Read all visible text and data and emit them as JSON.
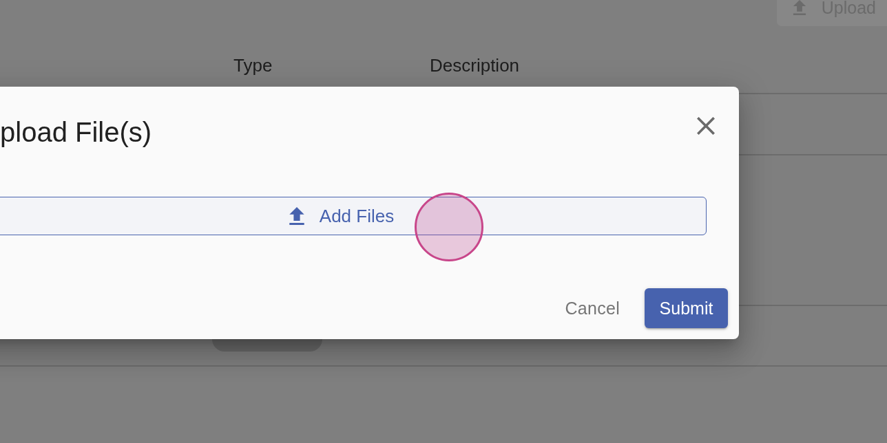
{
  "toolbar": {
    "upload_button": {
      "label": "Upload"
    }
  },
  "table": {
    "columns": [
      {
        "label": "Type"
      },
      {
        "label": "Description"
      }
    ]
  },
  "dialog": {
    "title": "pload File(s)",
    "add_files_button": {
      "label": "Add Files"
    },
    "cancel_button": {
      "label": "Cancel"
    },
    "submit_button": {
      "label": "Submit"
    }
  }
}
